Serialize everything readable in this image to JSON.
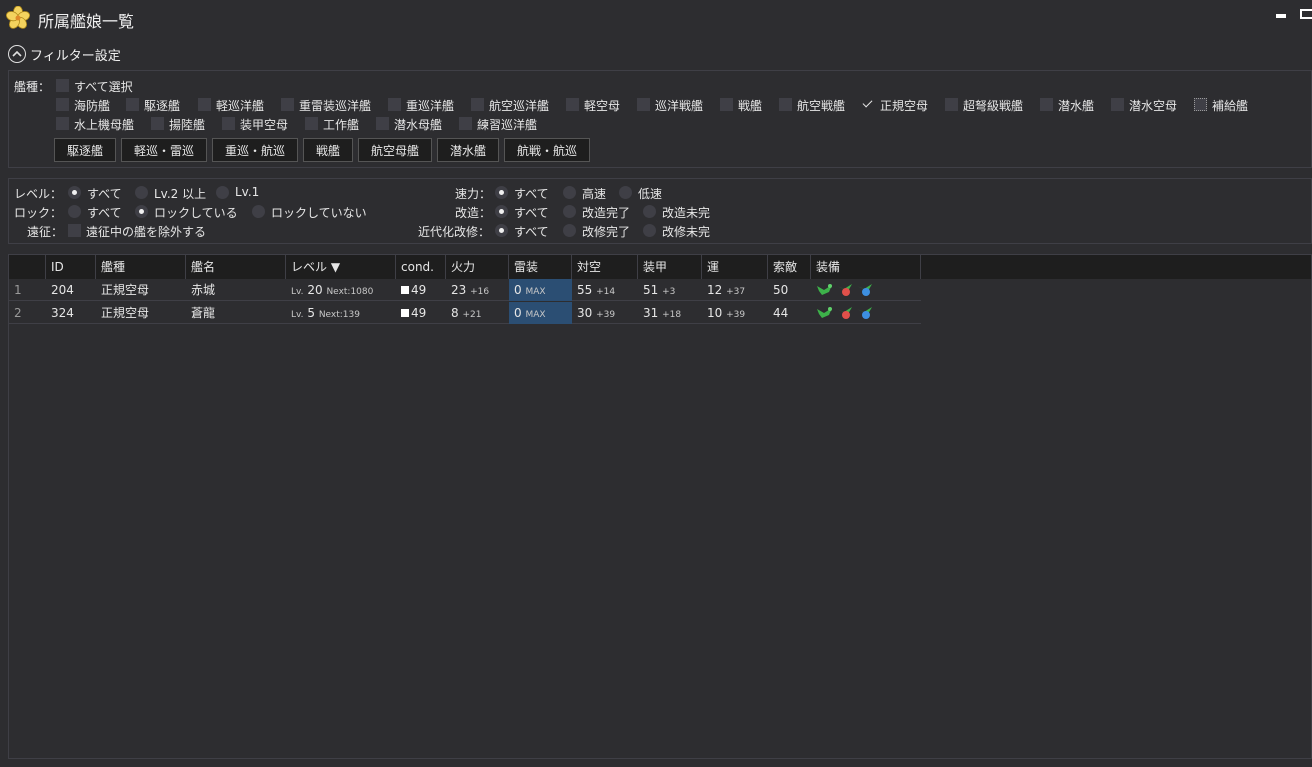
{
  "window": {
    "title": "所属艦娘一覧",
    "icon": "sakura-icon"
  },
  "filter": {
    "toggle_label": "フィルター設定",
    "ship_type_label": "艦種：",
    "select_all": "すべて選択",
    "ship_types": [
      {
        "label": "海防艦",
        "checked": false
      },
      {
        "label": "駆逐艦",
        "checked": false
      },
      {
        "label": "軽巡洋艦",
        "checked": false
      },
      {
        "label": "重雷装巡洋艦",
        "checked": false
      },
      {
        "label": "重巡洋艦",
        "checked": false
      },
      {
        "label": "航空巡洋艦",
        "checked": false
      },
      {
        "label": "軽空母",
        "checked": false
      },
      {
        "label": "巡洋戦艦",
        "checked": false
      },
      {
        "label": "戦艦",
        "checked": false
      },
      {
        "label": "航空戦艦",
        "checked": false
      },
      {
        "label": "正規空母",
        "checked": true
      },
      {
        "label": "超弩級戦艦",
        "checked": false
      },
      {
        "label": "潜水艦",
        "checked": false
      },
      {
        "label": "潜水空母",
        "checked": false
      },
      {
        "label": "補給艦",
        "checked": false
      },
      {
        "label": "水上機母艦",
        "checked": false
      },
      {
        "label": "揚陸艦",
        "checked": false
      },
      {
        "label": "装甲空母",
        "checked": false
      },
      {
        "label": "工作艦",
        "checked": false
      },
      {
        "label": "潜水母艦",
        "checked": false
      },
      {
        "label": "練習巡洋艦",
        "checked": false
      }
    ],
    "presets": [
      "駆逐艦",
      "軽巡・雷巡",
      "重巡・航巡",
      "戦艦",
      "航空母艦",
      "潜水艦",
      "航戦・航巡"
    ],
    "level": {
      "label": "レベル：",
      "options": [
        "すべて",
        "Lv.2 以上",
        "Lv.1"
      ],
      "selected": 0
    },
    "lock": {
      "label": "ロック：",
      "options": [
        "すべて",
        "ロックしている",
        "ロックしていない"
      ],
      "selected": 1
    },
    "expedition": {
      "label": "遠征：",
      "option": "遠征中の艦を除外する",
      "checked": false
    },
    "speed": {
      "label": "速力：",
      "options": [
        "すべて",
        "高速",
        "低速"
      ],
      "selected": 0
    },
    "remodel": {
      "label": "改造：",
      "options": [
        "すべて",
        "改造完了",
        "改造未完"
      ],
      "selected": 0
    },
    "modernize": {
      "label": "近代化改修：",
      "options": [
        "すべて",
        "改修完了",
        "改修未完"
      ],
      "selected": 0
    }
  },
  "table": {
    "columns": [
      "",
      "ID",
      "艦種",
      "艦名",
      "レベル ▼",
      "cond.",
      "火力",
      "雷装",
      "対空",
      "装甲",
      "運",
      "索敵",
      "装備"
    ],
    "rows": [
      {
        "num": "1",
        "id": "204",
        "type": "正規空母",
        "name": "赤城",
        "lv_prefix": "Lv.",
        "lv": "20",
        "next": "Next:1080",
        "cond": "49",
        "fire": "23",
        "fire_mod": "+16",
        "torp": "0",
        "torp_mod": "MAX",
        "aa": "55",
        "aa_mod": "+14",
        "armor": "51",
        "armor_mod": "+3",
        "luck": "12",
        "luck_mod": "+37",
        "los": "50",
        "equip": [
          "fighter-plane-icon",
          "dive-bomber-icon",
          "torpedo-bomber-icon"
        ]
      },
      {
        "num": "2",
        "id": "324",
        "type": "正規空母",
        "name": "蒼龍",
        "lv_prefix": "Lv.",
        "lv": "5",
        "next": "Next:139",
        "cond": "49",
        "fire": "8",
        "fire_mod": "+21",
        "torp": "0",
        "torp_mod": "MAX",
        "aa": "30",
        "aa_mod": "+39",
        "armor": "31",
        "armor_mod": "+18",
        "luck": "10",
        "luck_mod": "+39",
        "los": "44",
        "equip": [
          "fighter-plane-icon",
          "dive-bomber-icon",
          "torpedo-bomber-icon"
        ]
      }
    ]
  },
  "colors": {
    "background": "#2d2d30",
    "header": "#1e1e1e",
    "torpedo_highlight": "#2b4e73"
  }
}
